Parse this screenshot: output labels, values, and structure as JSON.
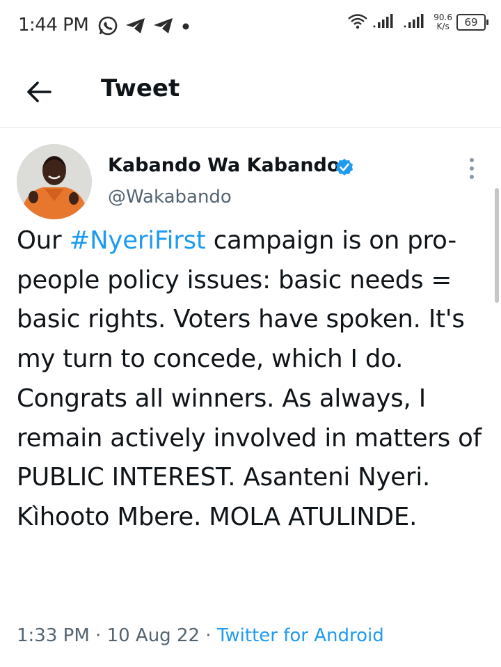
{
  "status_bar": {
    "time": "1:44 PM",
    "icons_left": [
      "whatsapp-icon",
      "telegram-icon",
      "telegram-icon",
      "dot-icon"
    ],
    "network_speed_value": "90.6",
    "network_speed_unit": "K/s",
    "battery": "69"
  },
  "header": {
    "back_icon": "arrow-left-icon",
    "title": "Tweet"
  },
  "tweet": {
    "author_name": "Kabando Wa Kabando",
    "verified": true,
    "handle": "@Wakabando",
    "text_before": "Our ",
    "hashtag": "#NyeriFirst",
    "text_after": " campaign is on pro-people policy issues: basic needs = basic rights. Voters have spoken. It's my turn to concede, which I do. Congrats all winners. As always, I remain actively involved in matters of PUBLIC INTEREST. Asanteni Nyeri. Kìhooto Mbere. MOLA ATULINDE.",
    "time": "1:33 PM",
    "date": "10 Aug 22",
    "separator": " · ",
    "source": "Twitter for Android"
  },
  "colors": {
    "accent": "#1d9bf0",
    "secondary_text": "#536471",
    "primary_text": "#0f1419"
  }
}
